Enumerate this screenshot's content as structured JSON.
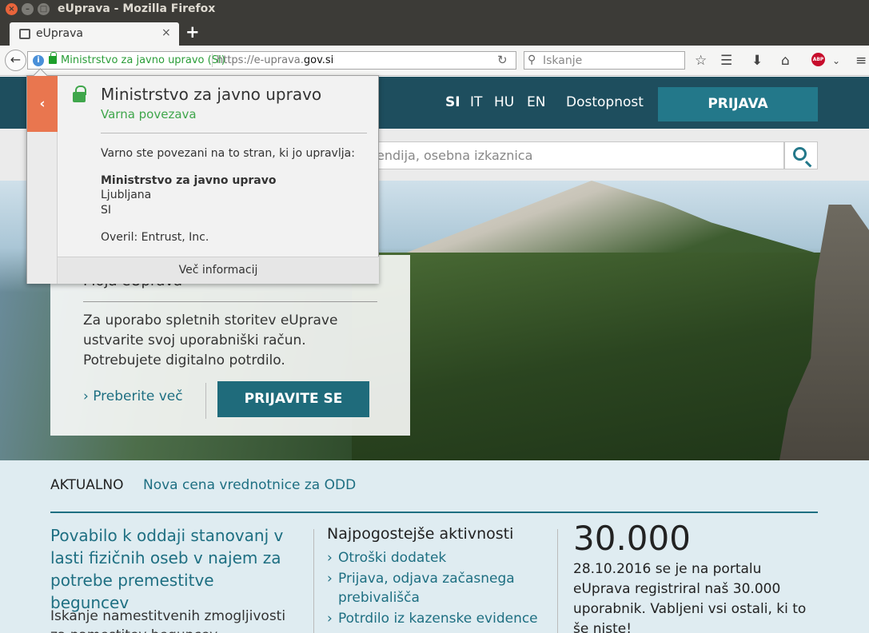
{
  "window": {
    "title": "eUprava - Mozilla Firefox"
  },
  "tab": {
    "label": "eUprava",
    "close": "×",
    "new_tab": "+"
  },
  "navbar": {
    "identity_label": "Ministrstvo za javno upravo (SI)",
    "url_prefix": "https://e-uprava.",
    "url_domain": "gov.si",
    "search_placeholder": "Iskanje",
    "abp_label": "ABP"
  },
  "site": {
    "languages": [
      {
        "label": "SI",
        "active": true
      },
      {
        "label": "IT"
      },
      {
        "label": "HU"
      },
      {
        "label": "EN"
      }
    ],
    "accessibility": "Dostopnost",
    "login_button": "PRIJAVA",
    "search_placeholder": "endija, osebna izkaznica"
  },
  "login_box": {
    "title": "Moja eUprava",
    "text": "Za uporabo spletnih storitev eUprave ustvarite svoj uporabniški račun. Potrebujete digitalno potrdilo.",
    "more_link": "› Preberite več",
    "button": "PRIJAVITE SE"
  },
  "news": {
    "label": "AKTUALNO",
    "link": "Nova cena vrednotnice za ODD"
  },
  "col1": {
    "title": "Povabilo k oddaji stanovanj v lasti fizičnih oseb v najem za potrebe premestitve beguncev",
    "text": "Iskanje namestitvenih zmogljivosti za namestitev beguncev"
  },
  "col2": {
    "title": "Najpogostejše aktivnosti",
    "items": [
      "Otroški dodatek",
      "Prijava, odjava začasnega prebivališča",
      "Potrdilo iz kazenske evidence"
    ]
  },
  "col3": {
    "number": "30.000",
    "text": "28.10.2016 se je na portalu eUprava registriral naš 30.000 uporabnik. Vabljeni vsi ostali, ki to še niste!"
  },
  "popup": {
    "back": "‹",
    "title": "Ministrstvo za javno upravo",
    "subtitle": "Varna povezava",
    "description": "Varno ste povezani na to stran, ki jo upravlja:",
    "org": "Ministrstvo za javno upravo",
    "city": "Ljubljana",
    "country": "SI",
    "verified_by": "Overil: Entrust, Inc.",
    "more_info": "Več informacij"
  },
  "colors": {
    "header": "#1e4e5e",
    "accent": "#23788a",
    "secure_green": "#3fa64b",
    "popup_back": "#e9764f"
  }
}
